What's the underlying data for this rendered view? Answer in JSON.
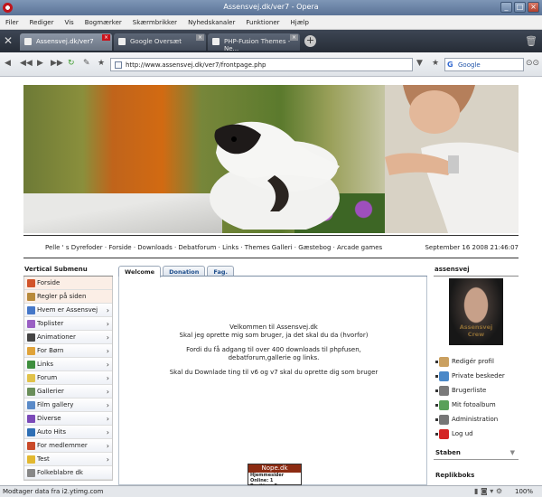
{
  "window": {
    "title": "Assensvej.dk/ver7 - Opera"
  },
  "menu": [
    "Filer",
    "Rediger",
    "Vis",
    "Bogmærker",
    "Skærmbrikker",
    "Nyhedskanaler",
    "Funktioner",
    "Hjælp"
  ],
  "tabs": [
    {
      "label": "Assensvej.dk/ver7"
    },
    {
      "label": "Google Oversæt"
    },
    {
      "label": "PHP-Fusion Themes - Ne..."
    }
  ],
  "address": {
    "url": "http://www.assensvej.dk/ver7/frontpage.php",
    "search_engine": "Google"
  },
  "site": {
    "nav_links": "Pelle ' s Dyrefoder · Forside · Downloads · Debatforum · Links · Themes Galleri · Gæstebog · Arcade games",
    "date": "September 16 2008 21:46:07"
  },
  "left": {
    "title": "Vertical Submenu",
    "items": [
      {
        "label": "Forside",
        "icon": "home-icon",
        "color": "#d2542a"
      },
      {
        "label": "Regler på siden",
        "icon": "rules-icon",
        "color": "#b88a3c"
      },
      {
        "label": "Hvem er Assensvej",
        "icon": "person-icon",
        "color": "#4577c8"
      },
      {
        "label": "Toplister",
        "icon": "list-icon",
        "color": "#9a5fc4"
      },
      {
        "label": "Animationer",
        "icon": "glasses-icon",
        "color": "#444444"
      },
      {
        "label": "For Børn",
        "icon": "hand-icon",
        "color": "#e0a33a"
      },
      {
        "label": "Links",
        "icon": "link-icon",
        "color": "#3e8e3e"
      },
      {
        "label": "Forum",
        "icon": "folder-icon",
        "color": "#e1c24a"
      },
      {
        "label": "Gallerier",
        "icon": "gallery-icon",
        "color": "#6a8e5a"
      },
      {
        "label": "Film gallery",
        "icon": "film-icon",
        "color": "#5a8ac8"
      },
      {
        "label": "Diverse",
        "icon": "misc-icon",
        "color": "#7b4ab8"
      },
      {
        "label": "Auto Hits",
        "icon": "auto-icon",
        "color": "#2f6fb5"
      },
      {
        "label": "For medlemmer",
        "icon": "members-icon",
        "color": "#c94a2a"
      },
      {
        "label": "Test",
        "icon": "warning-icon",
        "color": "#e2b830"
      },
      {
        "label": "Folkeblabre dk",
        "icon": "misc-icon",
        "color": "#888888"
      }
    ]
  },
  "center": {
    "tabs": [
      "Welcome",
      "Donation",
      "Fag."
    ],
    "lines": [
      "Velkommen til Assensvej.dk",
      "Skal jeg oprette mig som bruger, ja det skal du da (hvorfor)",
      "Fordi du få adgang til over 400 downloads til phpfusen,",
      "debatforum,gallerie og links.",
      "Skal du Downlade ting til v6 og v7 skal du oprette dig som bruger"
    ],
    "stats": {
      "title": "Nope.dk",
      "lines": [
        "Hjemmesider",
        "Online:   1",
        "Position:   5",
        "Besøg:   822.374"
      ]
    }
  },
  "right": {
    "username": "assensvej",
    "avatar_text": "Assensvej   Crew",
    "items": [
      {
        "label": "Redigér profil",
        "icon": "edit-profile-icon",
        "color": "#caa060"
      },
      {
        "label": "Private beskeder",
        "icon": "messages-icon",
        "color": "#4a88c8"
      },
      {
        "label": "Brugerliste",
        "icon": "userlist-icon",
        "color": "#7a7a7a"
      },
      {
        "label": "Mit fotoalbum",
        "icon": "photo-album-icon",
        "color": "#5aa05a"
      },
      {
        "label": "Administration",
        "icon": "admin-icon",
        "color": "#777777"
      },
      {
        "label": "Log ud",
        "icon": "logout-icon",
        "color": "#d42424"
      }
    ],
    "panel_staben": "Staben",
    "panel_replikboks": "Replikboks"
  },
  "status": {
    "text": "Modtager data fra i2.ytimg.com",
    "zoom": "100%"
  }
}
